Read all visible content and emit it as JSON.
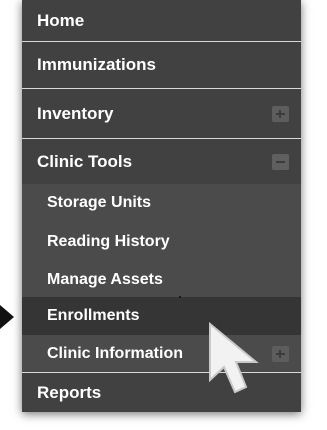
{
  "menu": {
    "items": [
      {
        "label": "Home",
        "toggle": null
      },
      {
        "label": "Immunizations",
        "toggle": null
      },
      {
        "label": "Inventory",
        "toggle": "plus"
      },
      {
        "label": "Clinic Tools",
        "toggle": "minus"
      },
      {
        "label": "Storage Units",
        "toggle": null
      },
      {
        "label": "Reading History",
        "toggle": null
      },
      {
        "label": "Manage Assets",
        "toggle": null
      },
      {
        "label": "Enrollments",
        "toggle": null
      },
      {
        "label": "Clinic Information",
        "toggle": "plus"
      },
      {
        "label": "Reports",
        "toggle": null
      }
    ]
  },
  "state": {
    "hovered_item": "Enrollments",
    "expanded_section": "Clinic Tools"
  },
  "colors": {
    "menu_background": "#3f3f3f",
    "submenu_background": "#4b4b4b",
    "active_background": "#353535",
    "text": "#ffffff",
    "divider": "#d8d8d8"
  },
  "icons": {
    "expand": "plus-square-icon",
    "collapse": "minus-square-icon",
    "pointer": "mouse-pointer-icon",
    "marker": "arrow-marker-icon"
  }
}
